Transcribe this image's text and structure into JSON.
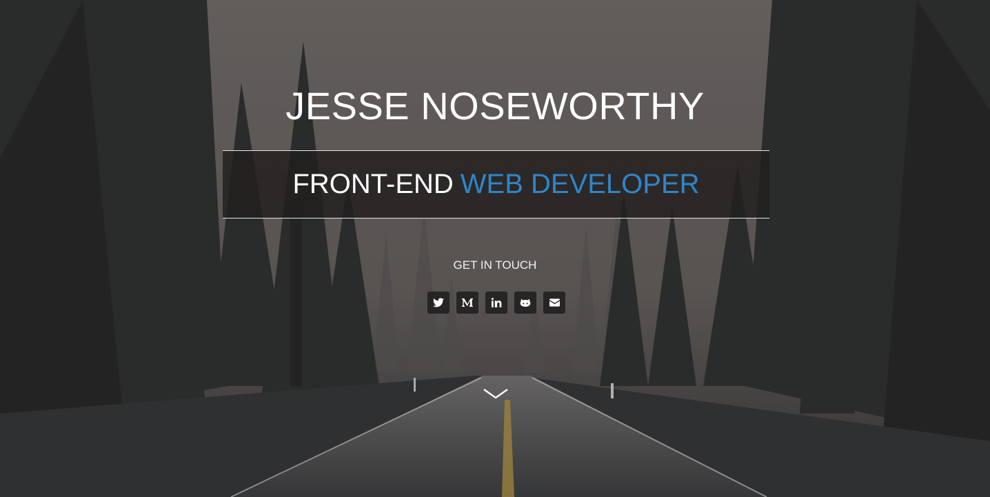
{
  "hero": {
    "name": "JESSE NOSEWORTHY",
    "role_prefix": "FRONT-END",
    "role_accent": "WEB DEVELOPER",
    "cta": "GET IN TOUCH"
  },
  "social": [
    {
      "icon": "twitter-icon"
    },
    {
      "icon": "medium-icon"
    },
    {
      "icon": "linkedin-icon"
    },
    {
      "icon": "github-icon"
    },
    {
      "icon": "envelope-icon"
    }
  ],
  "colors": {
    "accent": "#2f86c9",
    "text": "#ffffff",
    "box_bg": "#221e1d"
  },
  "scroll": {
    "icon": "chevron-down-icon"
  }
}
